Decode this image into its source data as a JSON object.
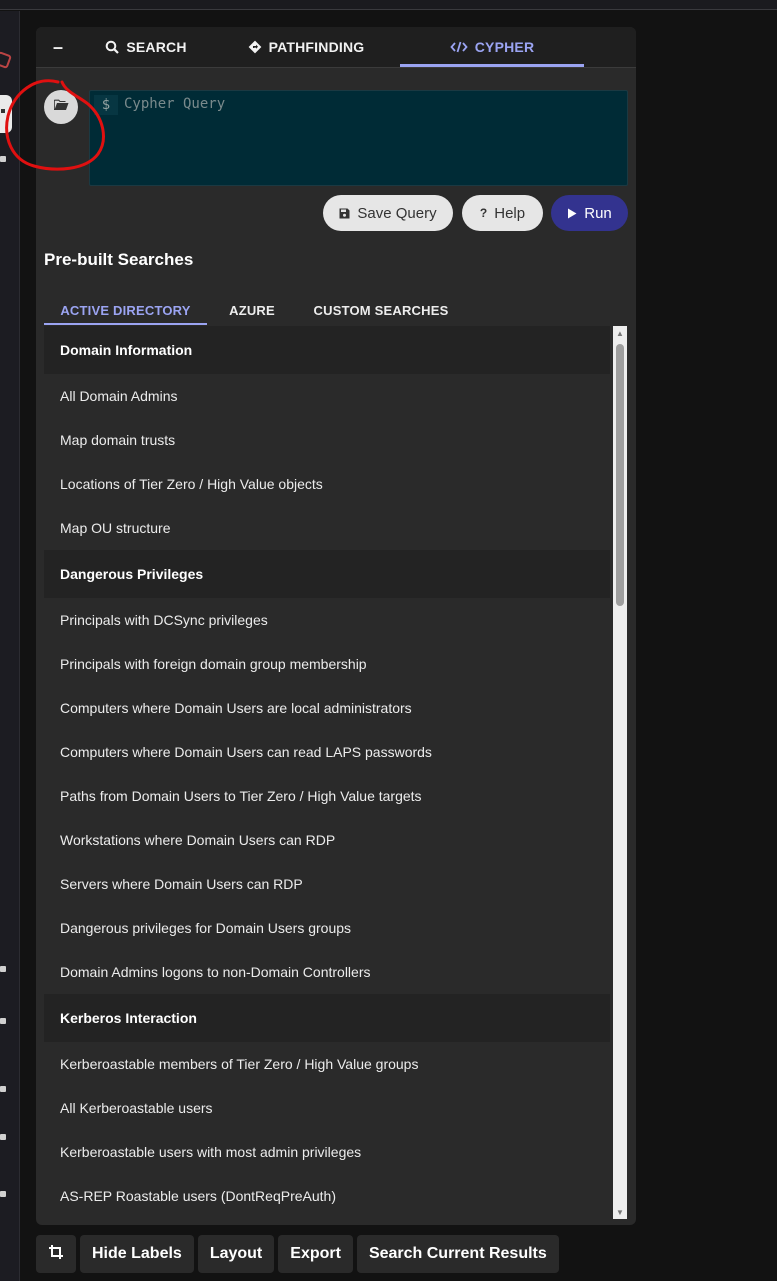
{
  "nav": {
    "collapse_label": "–",
    "tabs": [
      {
        "label": "SEARCH",
        "icon": "search-icon"
      },
      {
        "label": "PATHFINDING",
        "icon": "diamond-direction-icon"
      },
      {
        "label": "CYPHER",
        "icon": "code-icon",
        "active": true
      }
    ]
  },
  "editor": {
    "prompt": "$",
    "placeholder": "Cypher Query",
    "value": ""
  },
  "buttons": {
    "save": "Save Query",
    "help_prefix": "?",
    "help": "Help",
    "run": "Run"
  },
  "prebuilt": {
    "title": "Pre-built Searches",
    "tabs": [
      {
        "label": "ACTIVE DIRECTORY",
        "active": true
      },
      {
        "label": "AZURE"
      },
      {
        "label": "CUSTOM SEARCHES"
      }
    ],
    "rows": [
      {
        "text": "Domain Information",
        "header": true
      },
      {
        "text": "All Domain Admins"
      },
      {
        "text": "Map domain trusts"
      },
      {
        "text": "Locations of Tier Zero / High Value objects"
      },
      {
        "text": "Map OU structure"
      },
      {
        "text": "Dangerous Privileges",
        "header": true
      },
      {
        "text": "Principals with DCSync privileges"
      },
      {
        "text": "Principals with foreign domain group membership"
      },
      {
        "text": "Computers where Domain Users are local administrators"
      },
      {
        "text": "Computers where Domain Users can read LAPS passwords"
      },
      {
        "text": "Paths from Domain Users to Tier Zero / High Value targets"
      },
      {
        "text": "Workstations where Domain Users can RDP"
      },
      {
        "text": "Servers where Domain Users can RDP"
      },
      {
        "text": "Dangerous privileges for Domain Users groups"
      },
      {
        "text": "Domain Admins logons to non-Domain Controllers"
      },
      {
        "text": "Kerberos Interaction",
        "header": true
      },
      {
        "text": "Kerberoastable members of Tier Zero / High Value groups"
      },
      {
        "text": "All Kerberoastable users"
      },
      {
        "text": "Kerberoastable users with most admin privileges"
      },
      {
        "text": "AS-REP Roastable users (DontReqPreAuth)"
      }
    ]
  },
  "bottom": {
    "hide_labels": "Hide Labels",
    "layout": "Layout",
    "export": "Export",
    "search_current": "Search Current Results"
  },
  "colors": {
    "accent": "#9ba4f2",
    "run_button": "#33338f",
    "editor_bg": "#002b36",
    "panel_bg": "#2a2a2a",
    "annotation": "#e01010"
  }
}
